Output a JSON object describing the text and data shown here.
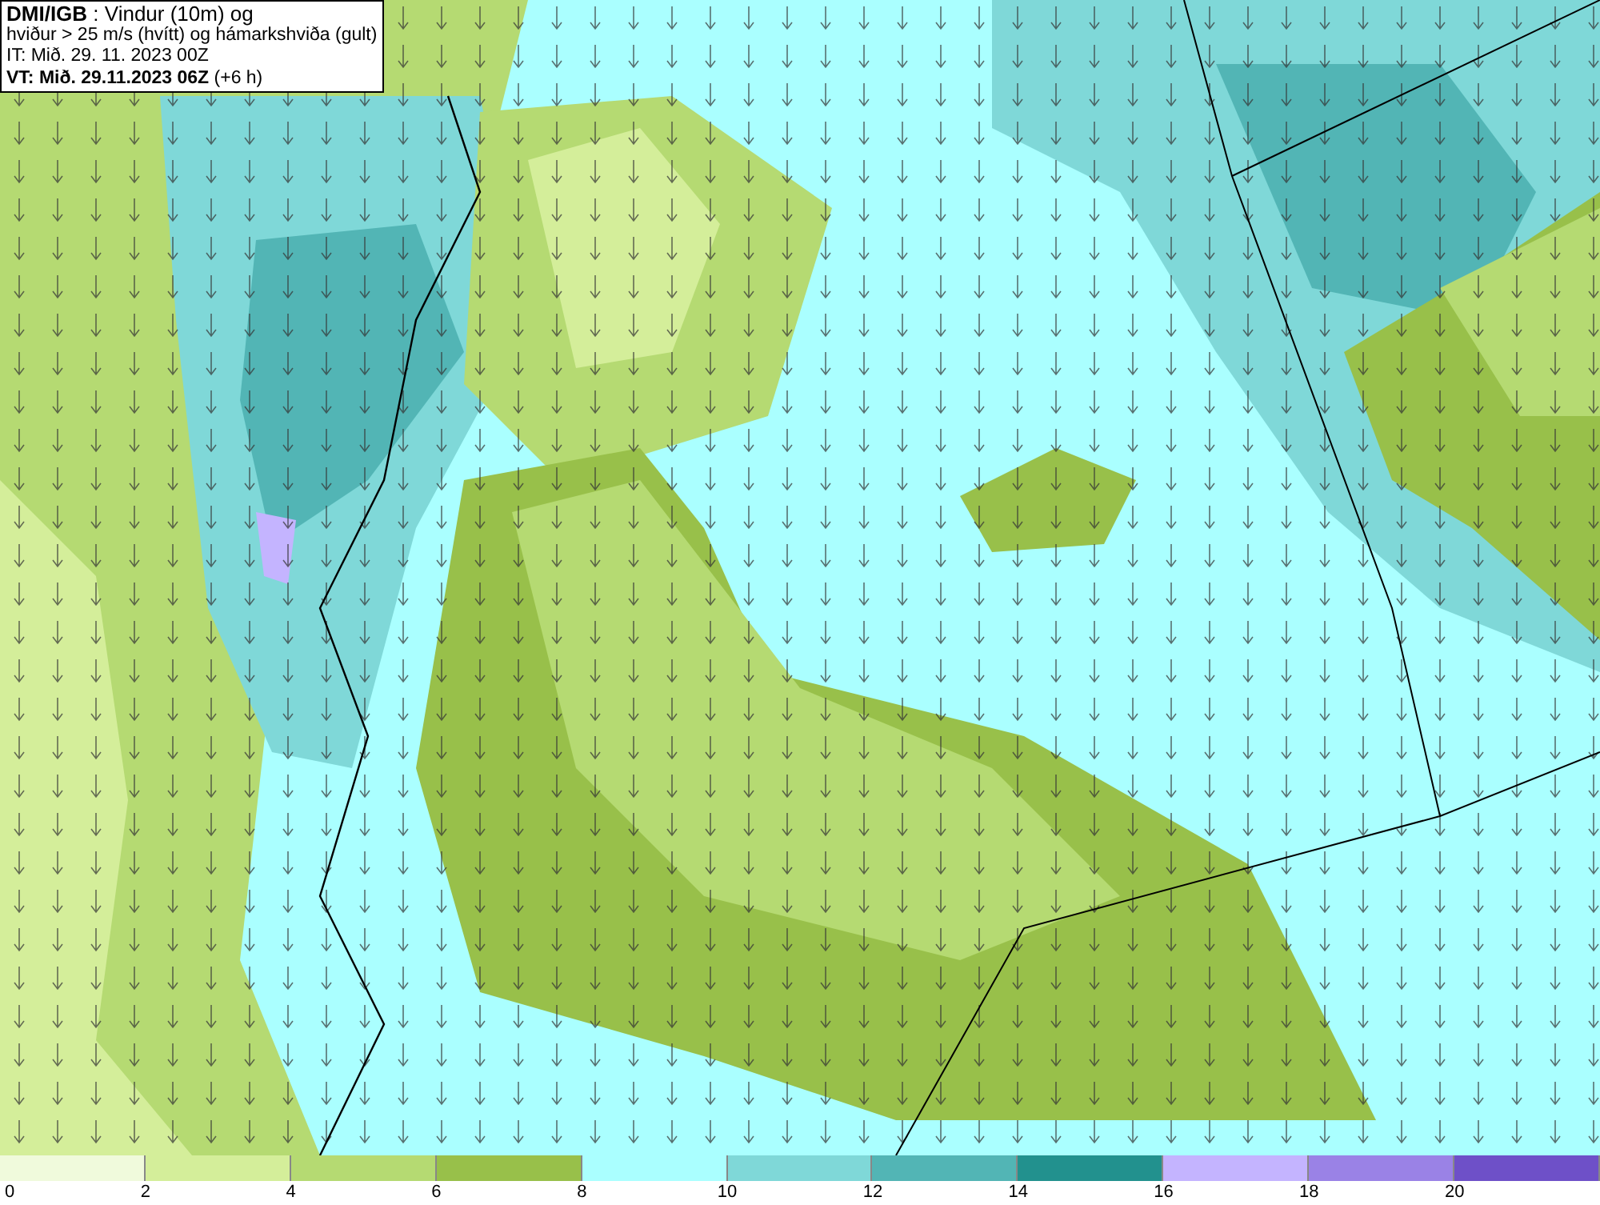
{
  "title_box": {
    "lines": [
      "**DMI/IGB** : Vindur (10m) og",
      "hviður > 25 m/s (hvítt) og hámarkshviða (gult)",
      "IT: Mið. 29. 11. 2023 00Z",
      "**VT: Mið. 29.11.2023 06Z** (+6 h)"
    ]
  },
  "legend": {
    "bins": [
      {
        "color": "#f0fadc"
      },
      {
        "color": "#d4ee9a"
      },
      {
        "color": "#b5da72"
      },
      {
        "color": "#98c04a"
      },
      {
        "color": "#aaffff"
      },
      {
        "color": "#7fd8d8"
      },
      {
        "color": "#52b5b5"
      },
      {
        "color": "#22918e"
      },
      {
        "color": "#c4b4ff"
      },
      {
        "color": "#9a82e6"
      },
      {
        "color": "#6e50c8"
      }
    ],
    "ticks": [
      "0",
      "2",
      "4",
      "6",
      "8",
      "10",
      "12",
      "14",
      "16",
      "18",
      "20"
    ]
  }
}
